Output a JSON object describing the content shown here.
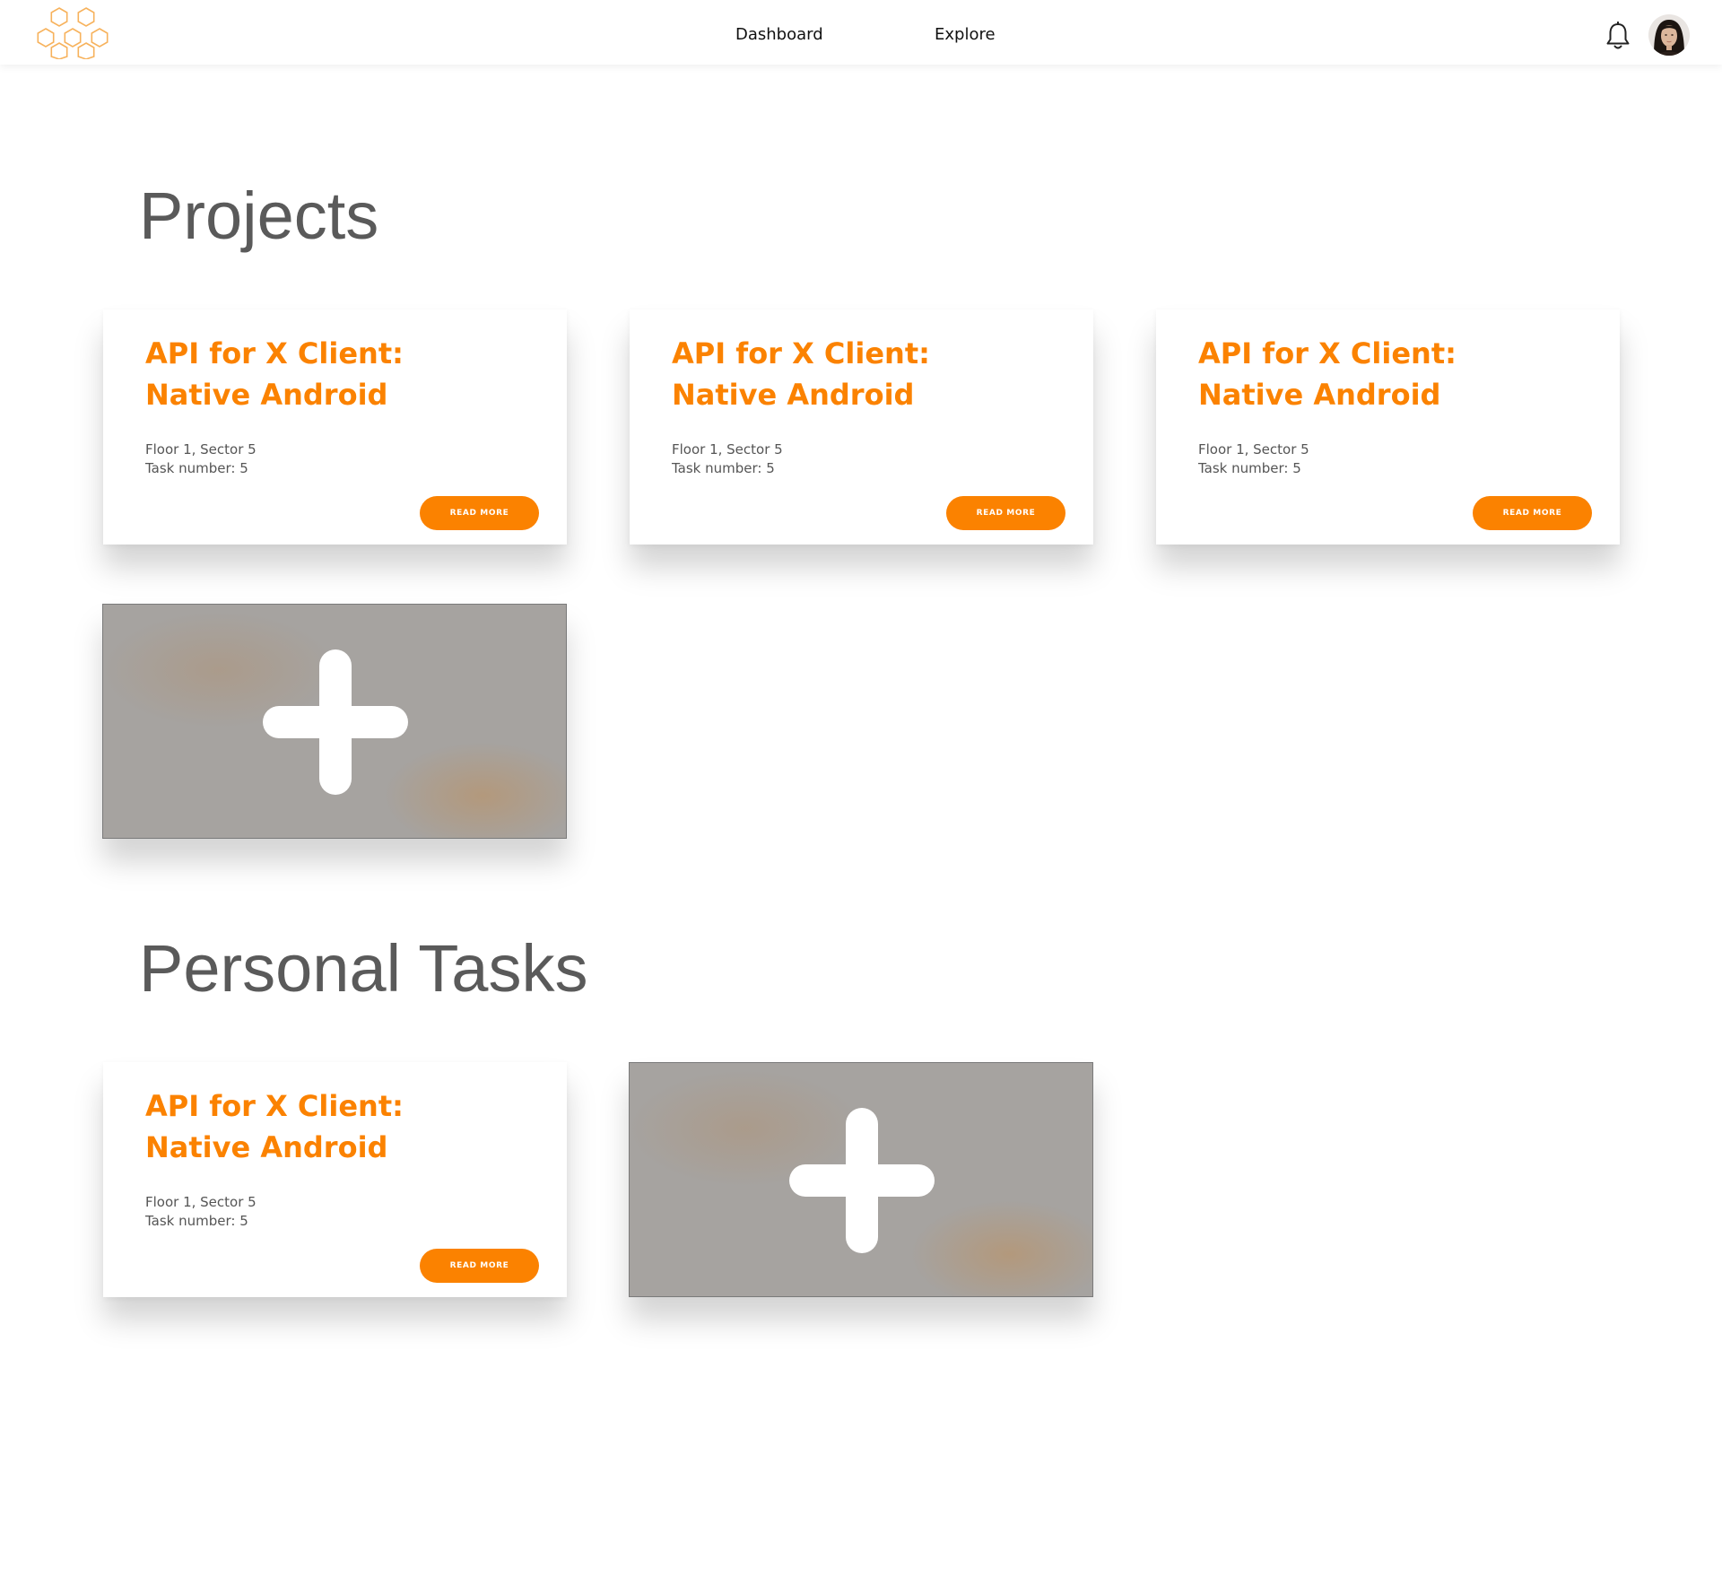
{
  "app": {
    "logo_icon": "honeycomb-logo-icon",
    "accent_color": "#fb8200"
  },
  "nav": {
    "links": [
      {
        "label": "Dashboard"
      },
      {
        "label": "Explore"
      }
    ],
    "notification_icon": "bell-icon",
    "avatar_icon": "user-avatar"
  },
  "sections": {
    "projects": {
      "title": "Projects",
      "cards": [
        {
          "title_line1": "API for X Client:",
          "title_line2": "Native Android",
          "location": "Floor 1, Sector 5",
          "task": "Task number: 5",
          "button": "READ MORE"
        },
        {
          "title_line1": "API for X Client:",
          "title_line2": "Native Android",
          "location": "Floor 1, Sector 5",
          "task": "Task number: 5",
          "button": "READ MORE"
        },
        {
          "title_line1": "API for X Client:",
          "title_line2": "Native Android",
          "location": "Floor 1, Sector 5",
          "task": "Task number: 5",
          "button": "READ MORE"
        }
      ],
      "add_tile_icon": "plus-icon"
    },
    "personal": {
      "title": "Personal Tasks",
      "cards": [
        {
          "title_line1": "API for X Client:",
          "title_line2": "Native Android",
          "location": "Floor 1, Sector 5",
          "task": "Task number: 5",
          "button": "READ MORE"
        }
      ],
      "add_tile_icon": "plus-icon"
    }
  }
}
